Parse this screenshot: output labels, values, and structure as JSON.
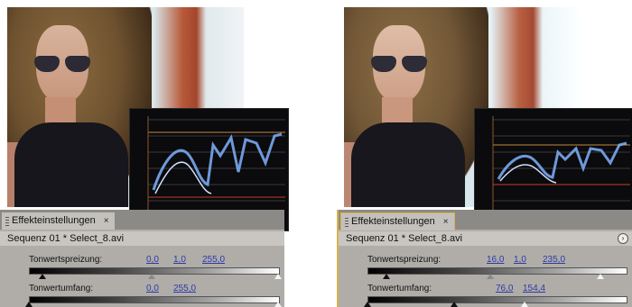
{
  "panels": [
    {
      "tab_label": "Effekteinstellungen",
      "tab_close": "×",
      "sequence_label": "Sequenz 01 * Select_8.avi",
      "input_label": "Tonwertspreizung:",
      "input_values": [
        "0,0",
        "1,0",
        "255,0"
      ],
      "output_label": "Tonwertumfang:",
      "output_values": [
        "0,0",
        "255,0"
      ]
    },
    {
      "tab_label": "Effekteinstellungen",
      "tab_close": "×",
      "sequence_label": "Sequenz 01 * Select_8.avi",
      "input_label": "Tonwertspreizung:",
      "input_values": [
        "16,0",
        "1,0",
        "235,0"
      ],
      "output_label": "Tonwertumfang:",
      "output_values": [
        "76,0",
        "154,4"
      ]
    }
  ],
  "colors": {
    "accent": "#d7b24f",
    "value_link": "#2b3aa8",
    "scope_trace": "#7fb3ff"
  },
  "icons": [
    "grip-icon",
    "close-icon",
    "panel-menu-icon"
  ]
}
